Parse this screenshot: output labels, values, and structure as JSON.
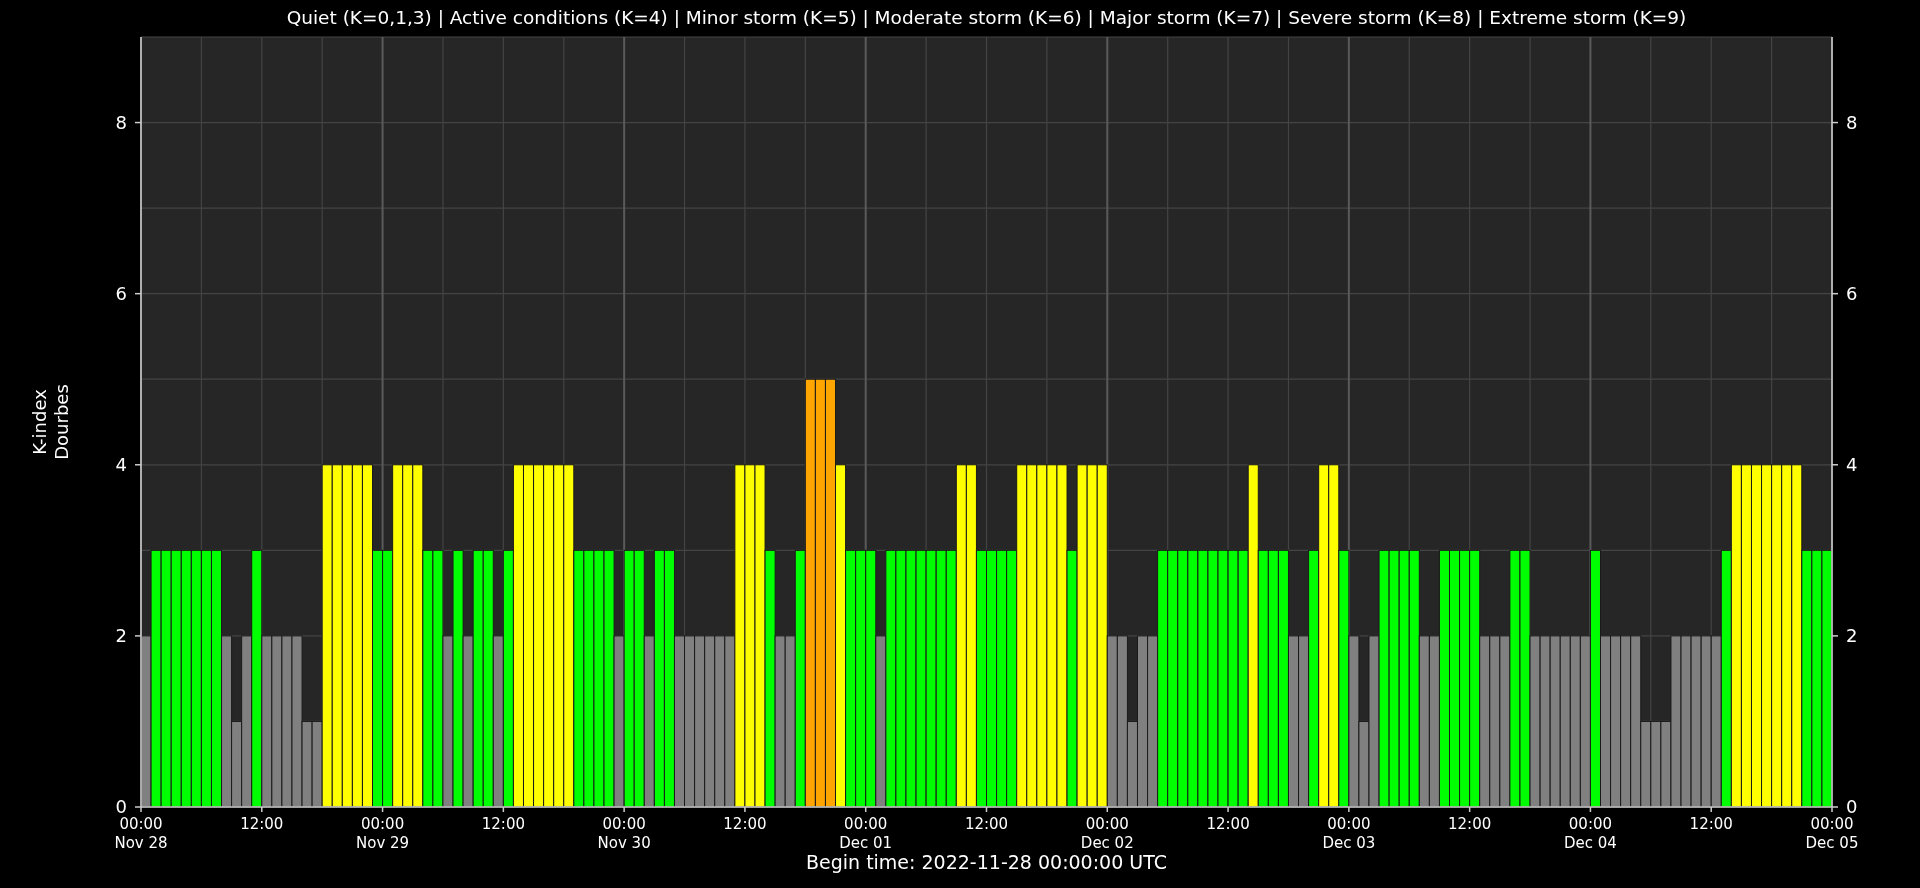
{
  "chart_data": {
    "type": "bar",
    "title": "Quiet (K=0,1,3) | Active conditions (K=4) | Minor storm (K=5) | Moderate storm (K=6) | Major storm (K=7) | Severe storm (K=8) | Extreme storm (K=9)",
    "xlabel": "Begin time: 2022-11-28 00:00:00 UTC",
    "ylabel": "K-index\nDourbes",
    "ylim": [
      0,
      9
    ],
    "yticks": [
      0,
      2,
      4,
      6,
      8
    ],
    "y2ticks": [
      0,
      2,
      4,
      6,
      8
    ],
    "y2lim": [
      0,
      9
    ],
    "categories": [
      "00:00\nNov 28",
      null,
      null,
      null,
      null,
      null,
      null,
      null,
      null,
      null,
      null,
      null,
      "12:00",
      null,
      null,
      null,
      null,
      null,
      null,
      null,
      null,
      null,
      null,
      null,
      "00:00\nNov 29",
      null,
      null,
      null,
      null,
      null,
      null,
      null,
      null,
      null,
      null,
      null,
      "12:00",
      null,
      null,
      null,
      null,
      null,
      null,
      null,
      null,
      null,
      null,
      null,
      "00:00\nNov 30",
      null,
      null,
      null,
      null,
      null,
      null,
      null,
      null,
      null,
      null,
      null,
      "12:00",
      null,
      null,
      null,
      null,
      null,
      null,
      null,
      null,
      null,
      null,
      null,
      "00:00\nDec 01",
      null,
      null,
      null,
      null,
      null,
      null,
      null,
      null,
      null,
      null,
      null,
      "12:00",
      null,
      null,
      null,
      null,
      null,
      null,
      null,
      null,
      null,
      null,
      null,
      "00:00\nDec 02",
      null,
      null,
      null,
      null,
      null,
      null,
      null,
      null,
      null,
      null,
      null,
      "12:00",
      null,
      null,
      null,
      null,
      null,
      null,
      null,
      null,
      null,
      null,
      null,
      "00:00\nDec 03",
      null,
      null,
      null,
      null,
      null,
      null,
      null,
      null,
      null,
      null,
      null,
      "12:00",
      null,
      null,
      null,
      null,
      null,
      null,
      null,
      null,
      null,
      null,
      null,
      "00:00\nDec 04",
      null,
      null,
      null,
      null,
      null,
      null,
      null,
      null,
      null,
      null,
      null,
      "12:00",
      null,
      null,
      null,
      null,
      null,
      null,
      null,
      null,
      null,
      null,
      null
    ],
    "annotations": [
      "00:00\nDec 05"
    ],
    "grid": true,
    "series": [
      {
        "values": [
          2,
          3,
          3,
          3,
          3,
          3,
          3,
          3,
          2,
          1,
          2,
          3,
          2,
          2,
          2,
          2,
          1,
          1,
          4,
          4,
          4,
          4,
          4,
          3,
          3,
          4,
          4,
          4,
          3,
          3,
          2,
          3,
          2,
          3,
          3,
          2,
          3,
          4,
          4,
          4,
          4,
          4,
          4,
          3,
          3,
          3,
          3,
          2,
          3,
          3,
          2,
          3,
          3,
          2,
          2,
          2,
          2,
          2,
          2,
          4,
          4,
          4,
          3,
          2,
          2,
          3,
          5,
          5,
          5,
          4,
          3,
          3,
          3,
          2,
          3,
          3,
          3,
          3,
          3,
          3,
          3,
          4,
          4,
          3,
          3,
          3,
          3,
          4,
          4,
          4,
          4,
          4,
          3,
          4,
          4,
          4,
          2,
          2,
          1,
          2,
          2,
          3,
          3,
          3,
          3,
          3,
          3,
          3,
          3,
          3,
          4,
          3,
          3,
          3,
          2,
          2,
          3,
          4,
          4,
          3,
          2,
          1,
          2,
          3,
          3,
          3,
          3,
          2,
          2,
          3,
          3,
          3,
          3,
          2,
          2,
          2,
          3,
          3,
          2,
          2,
          2,
          2,
          2,
          2,
          3,
          2,
          2,
          2,
          2,
          1,
          1,
          1,
          2,
          2,
          2,
          2,
          2,
          3,
          4,
          4,
          4,
          4,
          4,
          4,
          4,
          3,
          3,
          3
        ]
      }
    ]
  }
}
